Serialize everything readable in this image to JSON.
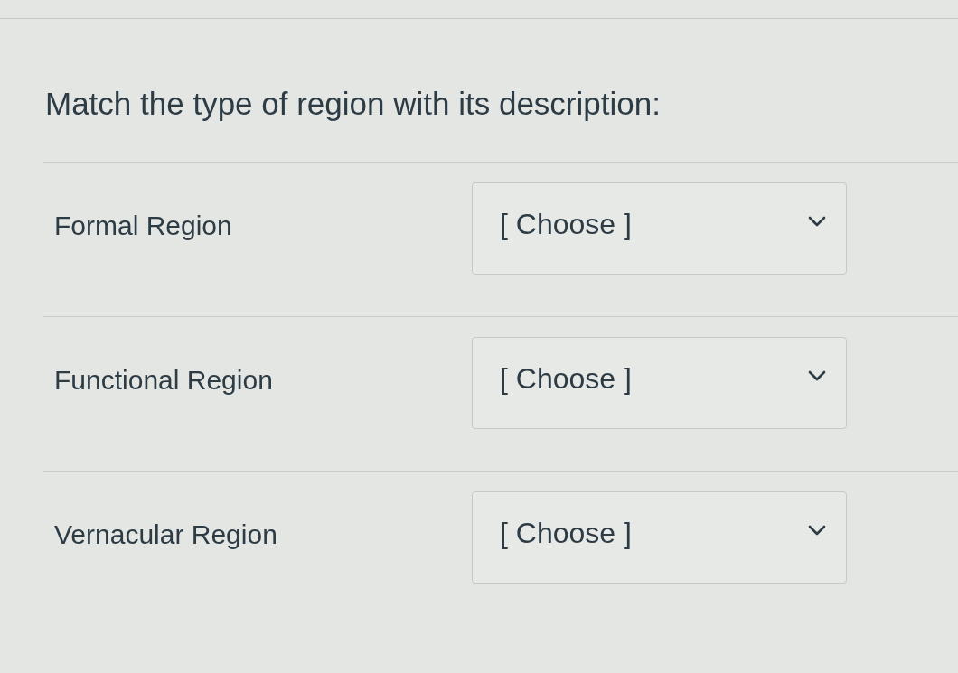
{
  "question": "Match the type of region with its description:",
  "items": [
    {
      "label": "Formal Region",
      "dropdown": {
        "value": "[ Choose ]"
      }
    },
    {
      "label": "Functional Region",
      "dropdown": {
        "value": "[ Choose ]"
      }
    },
    {
      "label": "Vernacular Region",
      "dropdown": {
        "value": "[ Choose ]"
      }
    }
  ]
}
